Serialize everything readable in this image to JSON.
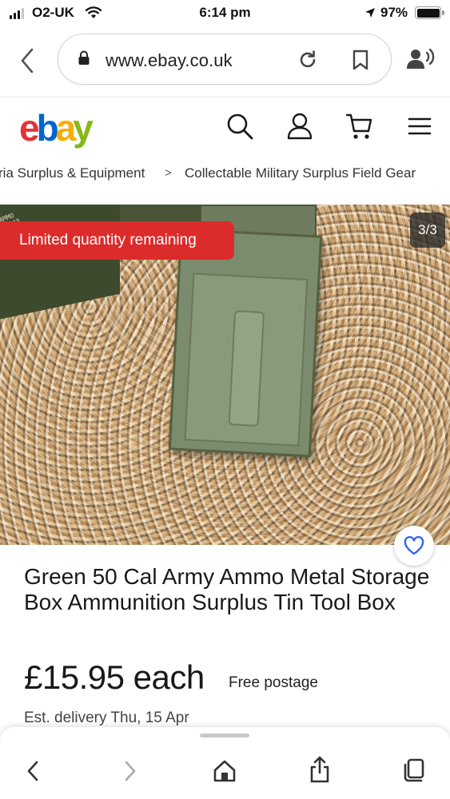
{
  "status_bar": {
    "carrier": "O2-UK",
    "time": "6:14 pm",
    "battery": "97%"
  },
  "browser": {
    "url": "www.ebay.co.uk"
  },
  "header": {
    "logo": {
      "e": "e",
      "b": "b",
      "a": "a",
      "y": "y"
    }
  },
  "breadcrumb": {
    "items": [
      "ria Surplus & Equipment",
      "Collectable Military Surplus Field Gear"
    ],
    "separator": ">"
  },
  "gallery": {
    "badge": "Limited quantity remaining",
    "counter": "3/3",
    "stencil": "AMMO\n0-043\n6.56\nCTG\nAMMO\n1749",
    "badge_color": "#dc2b2b"
  },
  "listing": {
    "title": "Green 50 Cal Army Ammo Metal Storage Box Ammunition Surplus Tin Tool Box",
    "price": "£15.95 each",
    "postage": "Free postage",
    "delivery": "Est. delivery Thu, 15 Apr"
  },
  "colors": {
    "ebay_red": "#e53238",
    "ebay_blue": "#0064d2",
    "ebay_yellow": "#f5af02",
    "ebay_green": "#86b817",
    "watch_heart": "#3665f3"
  },
  "icons": {
    "status": [
      "signal-icon",
      "wifi-icon",
      "location-arrow-icon",
      "battery-icon"
    ],
    "browser": [
      "back-chevron-icon",
      "lock-icon",
      "reload-icon",
      "bookmark-icon",
      "reader-voice-icon"
    ],
    "header": [
      "search-icon",
      "user-icon",
      "cart-icon",
      "menu-icon"
    ],
    "toolbar": [
      "back-icon",
      "forward-icon",
      "home-icon",
      "share-icon",
      "tabs-icon"
    ]
  }
}
